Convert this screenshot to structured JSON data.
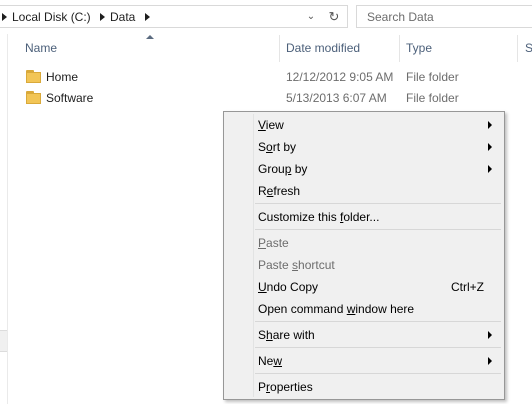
{
  "address": {
    "crumbs": [
      "Local Disk (C:)",
      "Data"
    ],
    "dropdown_icon": "chevron-down-icon",
    "refresh_icon": "refresh-icon"
  },
  "search": {
    "placeholder": "Search Data"
  },
  "columns": {
    "name": "Name",
    "date": "Date modified",
    "type": "Type",
    "size": "S"
  },
  "files": [
    {
      "name": "Home",
      "date": "12/12/2012 9:05 AM",
      "type": "File folder"
    },
    {
      "name": "Software",
      "date": "5/13/2013 6:07 AM",
      "type": "File folder"
    }
  ],
  "menu": {
    "view": {
      "pre": "",
      "u": "V",
      "post": "iew"
    },
    "sort_by": {
      "pre": "S",
      "u": "o",
      "post": "rt by"
    },
    "group_by": {
      "pre": "Grou",
      "u": "p",
      "post": " by"
    },
    "refresh": {
      "pre": "R",
      "u": "e",
      "post": "fresh"
    },
    "customize": {
      "pre": "Customize this ",
      "u": "f",
      "post": "older..."
    },
    "paste": {
      "pre": "",
      "u": "P",
      "post": "aste"
    },
    "paste_shortcut": {
      "pre": "Paste ",
      "u": "s",
      "post": "hortcut"
    },
    "undo_copy": {
      "pre": "",
      "u": "U",
      "post": "ndo Copy"
    },
    "undo_shortcut": "Ctrl+Z",
    "open_cmd": {
      "pre": "Open command ",
      "u": "w",
      "post": "indow here"
    },
    "share_with": {
      "pre": "S",
      "u": "h",
      "post": "are with"
    },
    "new": {
      "pre": "Ne",
      "u": "w",
      "post": ""
    },
    "properties": {
      "pre": "P",
      "u": "r",
      "post": "operties"
    }
  }
}
